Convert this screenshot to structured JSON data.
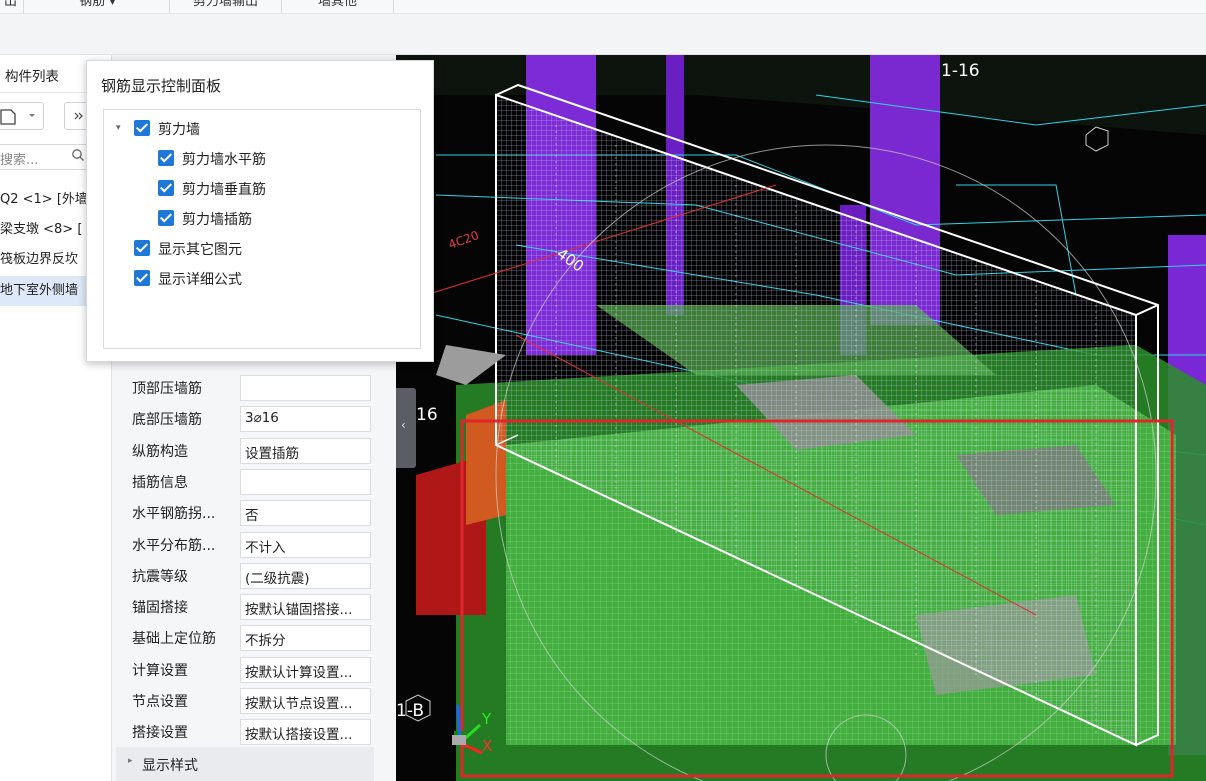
{
  "top_tabs": [
    {
      "label": "出"
    },
    {
      "label": "钢筋 ▾"
    },
    {
      "label": "剪力墙输出"
    },
    {
      "label": "墙其他"
    }
  ],
  "component_list": {
    "title": "构件列表",
    "search_placeholder": "搜索...",
    "items": [
      {
        "label": "Q2 <1> [外墙"
      },
      {
        "label": "梁支墩 <8> ["
      },
      {
        "label": "筏板边界反坎"
      },
      {
        "label": "地下室外侧墙"
      }
    ]
  },
  "properties": [
    {
      "label": "顶部压墙筋",
      "value": ""
    },
    {
      "label": "底部压墙筋",
      "value": "3⌀16"
    },
    {
      "label": "纵筋构造",
      "value": "设置插筋"
    },
    {
      "label": "插筋信息",
      "value": ""
    },
    {
      "label": "水平钢筋拐...",
      "value": "否"
    },
    {
      "label": "水平分布筋...",
      "value": "不计入"
    },
    {
      "label": "抗震等级",
      "value": "(二级抗震)"
    },
    {
      "label": "锚固搭接",
      "value": "按默认锚固搭接..."
    },
    {
      "label": "基础上定位筋",
      "value": "不拆分"
    },
    {
      "label": "计算设置",
      "value": "按默认计算设置..."
    },
    {
      "label": "节点设置",
      "value": "按默认节点设置..."
    },
    {
      "label": "搭接设置",
      "value": "按默认搭接设置..."
    }
  ],
  "display_style_group": "显示样式",
  "rebar_panel": {
    "title": "钢筋显示控制面板",
    "tree": [
      {
        "label": "剪力墙",
        "checked": true,
        "level": 0
      },
      {
        "label": "剪力墙水平筋",
        "checked": true,
        "level": 1
      },
      {
        "label": "剪力墙垂直筋",
        "checked": true,
        "level": 1
      },
      {
        "label": "剪力墙插筋",
        "checked": true,
        "level": 1
      },
      {
        "label": "显示其它图元",
        "checked": true,
        "level": 0
      },
      {
        "label": "显示详细公式",
        "checked": true,
        "level": 0
      }
    ]
  },
  "viewport": {
    "grid_labels": [
      "1-16",
      "16",
      "1-B",
      "4C20",
      "400"
    ],
    "axis_y": "Y",
    "axis_x": "X",
    "selection_color": "#e0262b"
  }
}
